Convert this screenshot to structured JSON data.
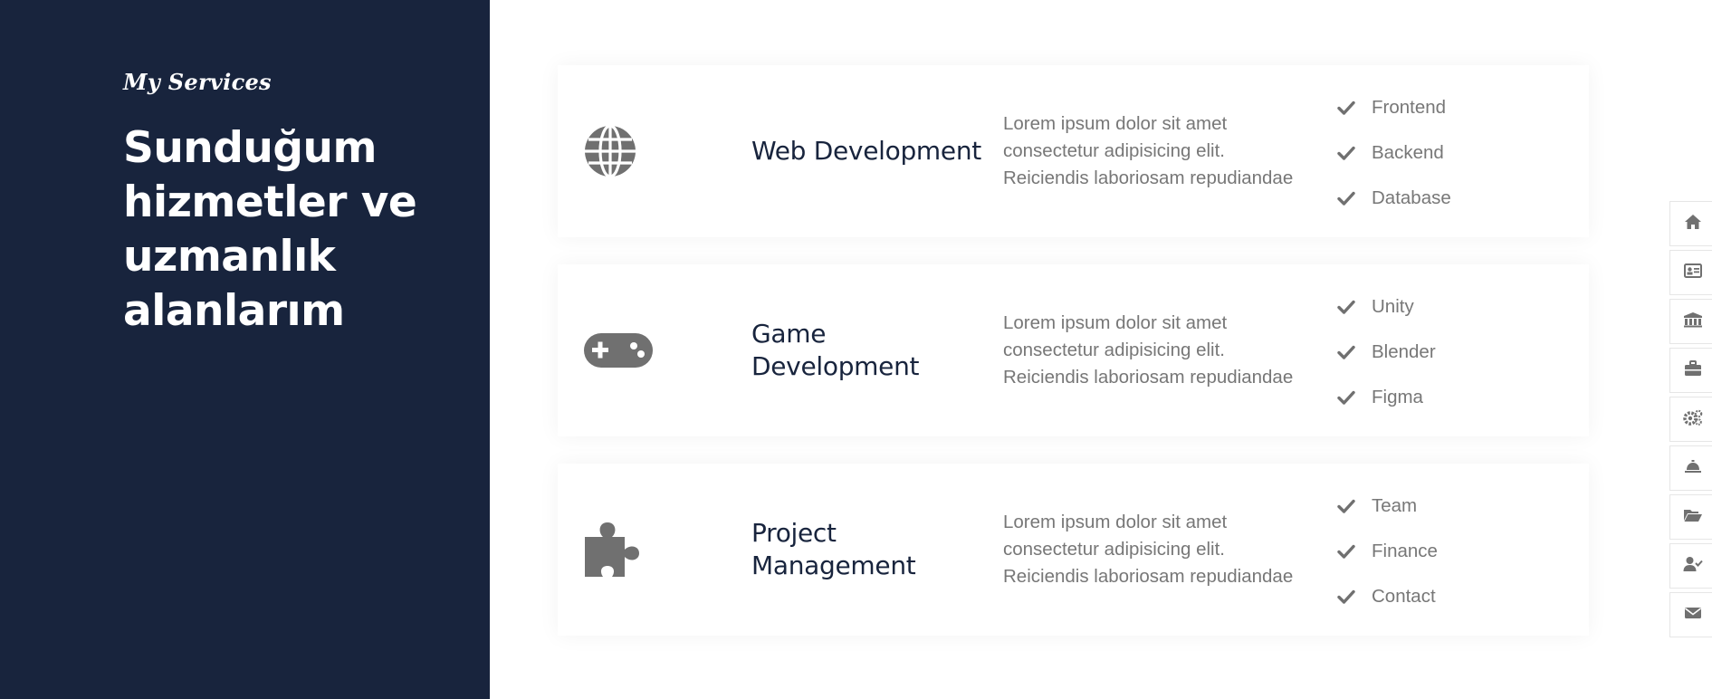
{
  "left_panel": {
    "subtitle": "My Services",
    "heading": "Sunduğum hizmetler ve uzmanlık alanlarım"
  },
  "services": [
    {
      "icon": "globe-icon",
      "title": "Web Development",
      "description": "Lorem ipsum dolor sit amet consectetur adipisicing elit. Reiciendis laboriosam repudiandae",
      "items": [
        "Frontend",
        "Backend",
        "Database"
      ]
    },
    {
      "icon": "gamepad-icon",
      "title": "Game Development",
      "description": "Lorem ipsum dolor sit amet consectetur adipisicing elit. Reiciendis laboriosam repudiandae",
      "items": [
        "Unity",
        "Blender",
        "Figma"
      ]
    },
    {
      "icon": "puzzle-icon",
      "title": "Project Management",
      "description": "Lorem ipsum dolor sit amet consectetur adipisicing elit. Reiciendis laboriosam repudiandae",
      "items": [
        "Team",
        "Finance",
        "Contact"
      ]
    }
  ],
  "side_nav": [
    {
      "icon": "home-icon"
    },
    {
      "icon": "id-card-icon"
    },
    {
      "icon": "university-icon"
    },
    {
      "icon": "briefcase-icon"
    },
    {
      "icon": "gears-icon"
    },
    {
      "icon": "concierge-bell-icon"
    },
    {
      "icon": "folder-open-icon"
    },
    {
      "icon": "user-check-icon"
    },
    {
      "icon": "envelope-icon"
    }
  ],
  "colors": {
    "panel_bg": "#18243d",
    "title_text": "#18243d",
    "body_text": "#777777",
    "icon_gray": "#707070"
  }
}
